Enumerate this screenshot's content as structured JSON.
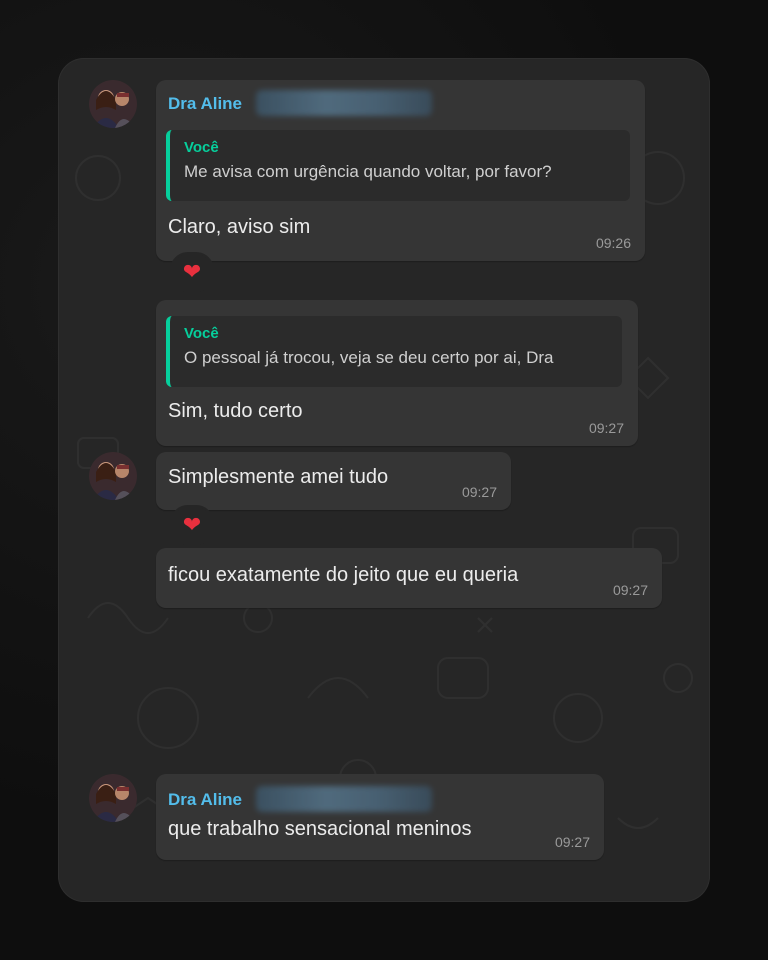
{
  "contact": {
    "name": "Dra Aline",
    "name_color": "#53bdeb"
  },
  "quote_color": "#06cf9c",
  "messages": [
    {
      "quote": {
        "author": "Você",
        "text": "Me avisa com urgência quando voltar, por favor?"
      },
      "text": "Claro, aviso sim",
      "time": "09:26",
      "reaction": "heart"
    },
    {
      "quote": {
        "author": "Você",
        "text": "O pessoal já trocou, veja se deu certo por ai, Dra"
      },
      "text": "Sim, tudo certo",
      "time": "09:27"
    },
    {
      "text": "Simplesmente amei tudo",
      "time": "09:27",
      "reaction": "heart"
    },
    {
      "text": "ficou exatamente do jeito que eu queria",
      "time": "09:27"
    },
    {
      "text": "que trabalho sensacional meninos",
      "time": "09:27"
    }
  ]
}
